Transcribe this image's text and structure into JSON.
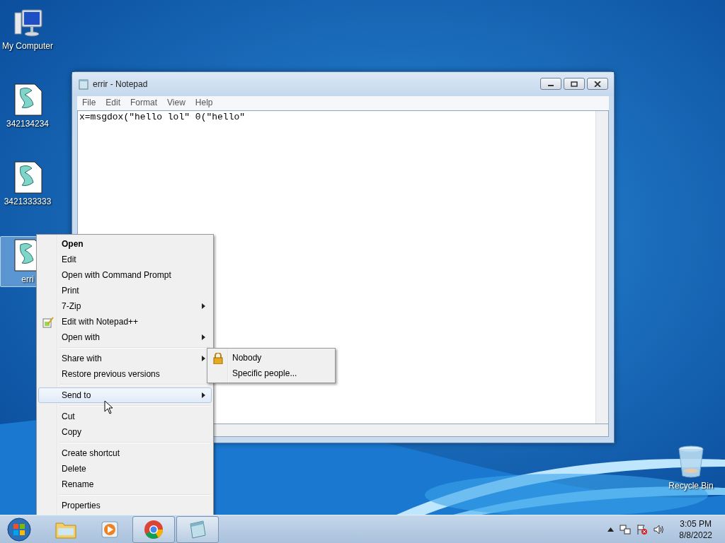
{
  "desktop_icons": [
    {
      "label": "My Computer",
      "kind": "computer",
      "selected": false
    },
    {
      "label": "342134234",
      "kind": "script",
      "selected": false
    },
    {
      "label": "3421333333",
      "kind": "script",
      "selected": false
    },
    {
      "label": "erri",
      "kind": "script",
      "selected": true
    },
    {
      "label": "Recycle Bin",
      "kind": "bin",
      "selected": false
    }
  ],
  "notepad": {
    "title": "errir - Notepad",
    "menu": [
      "File",
      "Edit",
      "Format",
      "View",
      "Help"
    ],
    "text": "x=msgdox(\"hello lol\" 0(\"hello\""
  },
  "context_menu": {
    "groups": [
      [
        {
          "label": "Open",
          "bold": true,
          "submenu": false,
          "selected": false
        },
        {
          "label": "Edit",
          "bold": false,
          "submenu": false,
          "selected": false
        },
        {
          "label": "Open with Command Prompt",
          "bold": false,
          "submenu": false,
          "selected": false
        },
        {
          "label": "Print",
          "bold": false,
          "submenu": false,
          "selected": false
        },
        {
          "label": "7-Zip",
          "bold": false,
          "submenu": true,
          "selected": false
        },
        {
          "label": "Edit with Notepad++",
          "bold": false,
          "submenu": false,
          "selected": false,
          "kind": "notepadpp"
        },
        {
          "label": "Open with",
          "bold": false,
          "submenu": true,
          "selected": false
        }
      ],
      [
        {
          "label": "Share with",
          "bold": false,
          "submenu": true,
          "selected": false
        },
        {
          "label": "Restore previous versions",
          "bold": false,
          "submenu": false,
          "selected": false
        }
      ],
      [
        {
          "label": "Send to",
          "bold": false,
          "submenu": true,
          "selected": true
        }
      ],
      [
        {
          "label": "Cut",
          "bold": false,
          "submenu": false,
          "selected": false
        },
        {
          "label": "Copy",
          "bold": false,
          "submenu": false,
          "selected": false
        }
      ],
      [
        {
          "label": "Create shortcut",
          "bold": false,
          "submenu": false,
          "selected": false
        },
        {
          "label": "Delete",
          "bold": false,
          "submenu": false,
          "selected": false
        },
        {
          "label": "Rename",
          "bold": false,
          "submenu": false,
          "selected": false
        }
      ],
      [
        {
          "label": "Properties",
          "bold": false,
          "submenu": false,
          "selected": false
        }
      ]
    ]
  },
  "submenu": [
    {
      "label": "Nobody",
      "kind": "lock"
    },
    {
      "label": "Specific people...",
      "kind": "plain"
    }
  ],
  "taskbar": {
    "apps": [
      {
        "kind": "explorer",
        "running": false
      },
      {
        "kind": "media",
        "running": false
      },
      {
        "kind": "chrome",
        "running": true
      },
      {
        "kind": "notepad",
        "running": true
      }
    ],
    "time": "3:05 PM",
    "date": "8/8/2022"
  }
}
